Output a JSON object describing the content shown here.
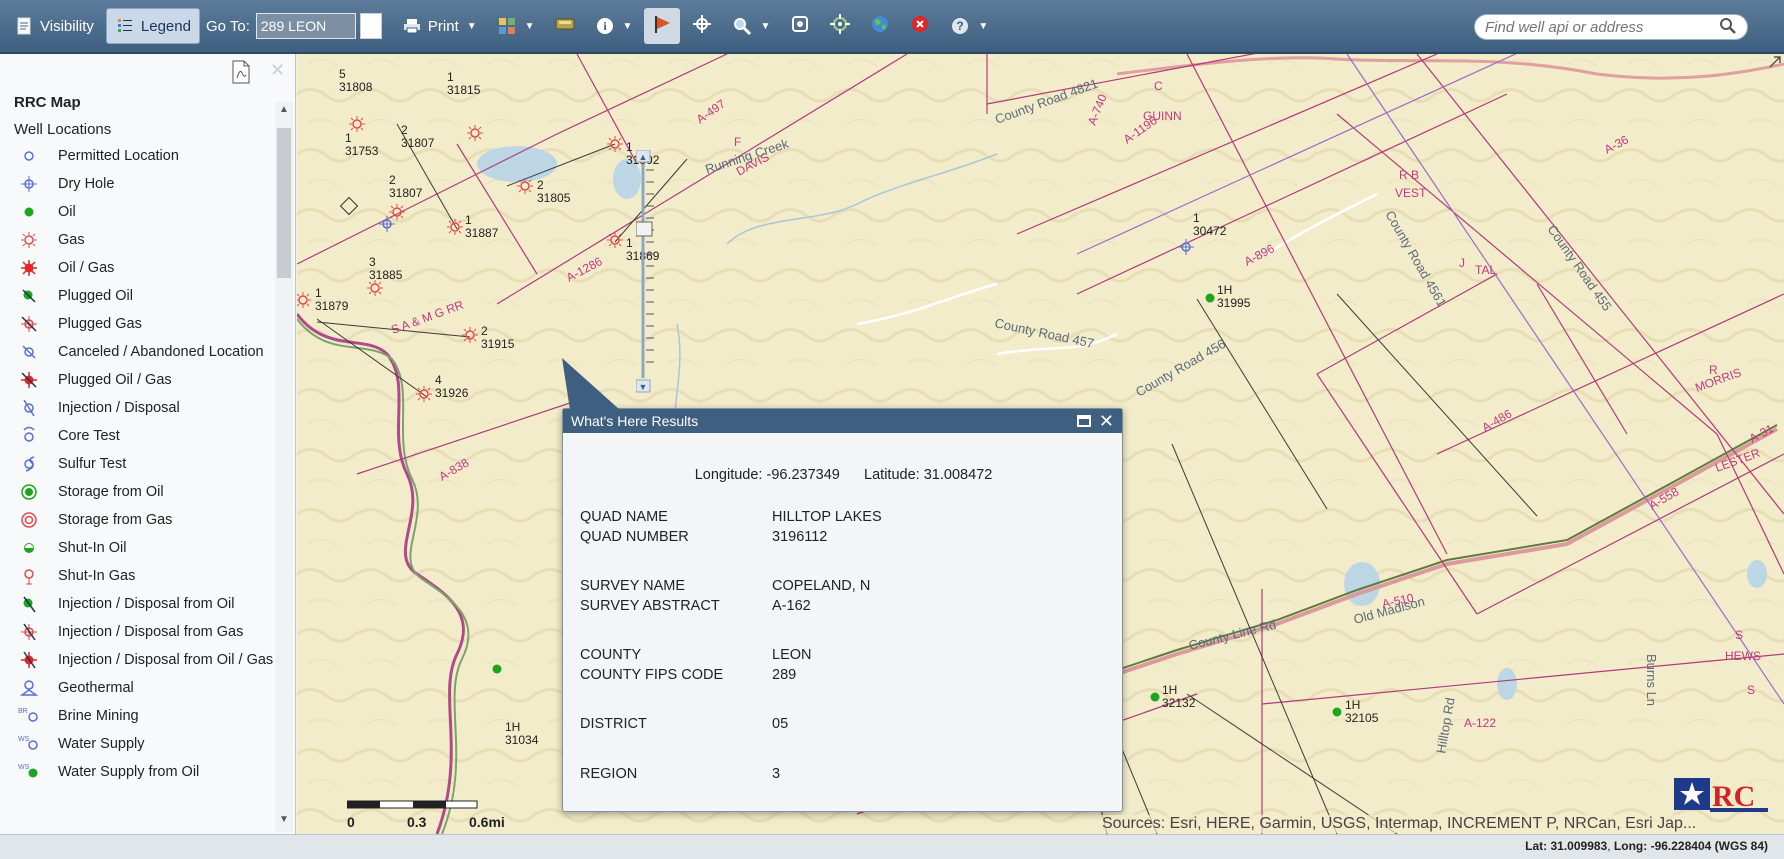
{
  "toolbar": {
    "visibility_label": "Visibility",
    "legend_label": "Legend",
    "goto_label": "Go To:",
    "goto_value": "289 LEON",
    "print_label": "Print",
    "search_placeholder": "Find well api or address"
  },
  "sidebar": {
    "title": "RRC Map",
    "subtitle": "Well Locations",
    "items": [
      {
        "label": "Permitted Location",
        "icon": "permitted-location-icon"
      },
      {
        "label": "Dry Hole",
        "icon": "dry-hole-icon"
      },
      {
        "label": "Oil",
        "icon": "oil-icon"
      },
      {
        "label": "Gas",
        "icon": "gas-icon"
      },
      {
        "label": "Oil / Gas",
        "icon": "oil-gas-icon"
      },
      {
        "label": "Plugged Oil",
        "icon": "plugged-oil-icon"
      },
      {
        "label": "Plugged Gas",
        "icon": "plugged-gas-icon"
      },
      {
        "label": "Canceled / Abandoned Location",
        "icon": "canceled-location-icon"
      },
      {
        "label": "Plugged Oil / Gas",
        "icon": "plugged-oil-gas-icon"
      },
      {
        "label": "Injection / Disposal",
        "icon": "injection-disposal-icon"
      },
      {
        "label": "Core Test",
        "icon": "core-test-icon"
      },
      {
        "label": "Sulfur Test",
        "icon": "sulfur-test-icon"
      },
      {
        "label": "Storage from Oil",
        "icon": "storage-oil-icon"
      },
      {
        "label": "Storage from Gas",
        "icon": "storage-gas-icon"
      },
      {
        "label": "Shut-In Oil",
        "icon": "shut-in-oil-icon"
      },
      {
        "label": "Shut-In Gas",
        "icon": "shut-in-gas-icon"
      },
      {
        "label": "Injection / Disposal from Oil",
        "icon": "injection-oil-icon"
      },
      {
        "label": "Injection / Disposal from Gas",
        "icon": "injection-gas-icon"
      },
      {
        "label": "Injection / Disposal from Oil / Gas",
        "icon": "injection-oil-gas-icon"
      },
      {
        "label": "Geothermal",
        "icon": "geothermal-icon"
      },
      {
        "label": "Brine Mining",
        "icon": "brine-mining-icon"
      },
      {
        "label": "Water Supply",
        "icon": "water-supply-icon"
      },
      {
        "label": "Water Supply from Oil",
        "icon": "water-supply-oil-icon"
      }
    ]
  },
  "popup": {
    "title": "What's Here Results",
    "longitude_label": "Longitude:",
    "longitude": "-96.237349",
    "latitude_label": "Latitude:",
    "latitude": "31.008472",
    "rows": [
      {
        "label": "QUAD NAME",
        "value": "HILLTOP LAKES"
      },
      {
        "label": "QUAD NUMBER",
        "value": "3196112"
      },
      {
        "label": "SURVEY NAME",
        "value": "COPELAND, N"
      },
      {
        "label": "SURVEY ABSTRACT",
        "value": "A-162"
      },
      {
        "label": "COUNTY",
        "value": "LEON"
      },
      {
        "label": "COUNTY FIPS CODE",
        "value": "289"
      },
      {
        "label": "DISTRICT",
        "value": "05"
      },
      {
        "label": "REGION",
        "value": "3"
      }
    ]
  },
  "map": {
    "sources": "Sources: Esri, HERE, Garmin, USGS, Intermap, INCREMENT P, NRCan, Esri Jap...",
    "scale_labels": [
      "0",
      "0.3",
      "0.6mi"
    ],
    "well_labels": [
      {
        "a": "5",
        "b": "31808"
      },
      {
        "a": "1",
        "b": "31815"
      },
      {
        "a": "1",
        "b": "31753"
      },
      {
        "a": "2",
        "b": "31807"
      },
      {
        "a": "2",
        "b": "31807"
      },
      {
        "a": "1",
        "b": "31802"
      },
      {
        "a": "2",
        "b": "31805"
      },
      {
        "a": "1",
        "b": "31887"
      },
      {
        "a": "1",
        "b": "31869"
      },
      {
        "a": "3",
        "b": "31885"
      },
      {
        "a": "1",
        "b": "31879"
      },
      {
        "a": "2",
        "b": "31915"
      },
      {
        "a": "4",
        "b": "31926"
      },
      {
        "a": "1",
        "b": "30472"
      },
      {
        "a": "1H",
        "b": "31995"
      },
      {
        "a": "1H",
        "b": "32132"
      },
      {
        "a": "1H",
        "b": "32105"
      },
      {
        "a": "1H",
        "b": "31034"
      }
    ],
    "survey_labels": [
      "C",
      "GUINN",
      "A-1196",
      "A-740",
      "A-497",
      "F",
      "DAVIS",
      "R B",
      "VEST",
      "A-896",
      "A-36",
      "J",
      "TAL",
      "A-1286",
      "S A & M G RR",
      "R",
      "MORRIS",
      "S",
      "LESTER",
      "A-486",
      "A-558",
      "A-31",
      "A-838",
      "S",
      "HEWS",
      "A-122",
      "A-510"
    ],
    "road_labels": [
      "County Road 4821",
      "Running Creek",
      "County Road 457",
      "County Road 456",
      "County Road 4561",
      "County Road 455",
      "County Line Rd",
      "Old Madison",
      "Burns Ln",
      "Hilltop Rd"
    ]
  },
  "status": {
    "lat_label": "Lat:",
    "lat": "31.009983",
    "long_label": "Long:",
    "long": "-96.228404",
    "datum": "(WGS 84)"
  }
}
